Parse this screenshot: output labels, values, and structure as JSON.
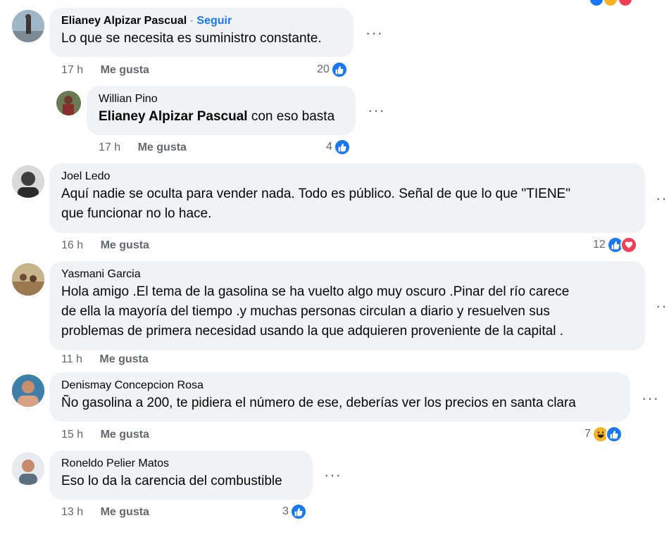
{
  "comments": [
    {
      "author": "Elianey Alpizar Pascual",
      "separator": "·",
      "follow_label": "Seguir",
      "text": "Lo que se necesita es suministro constante.",
      "time": "17 h",
      "like_label": "Me gusta",
      "reaction_count": "20",
      "reactions": [
        "like-icon"
      ]
    },
    {
      "author": "Willian Pino",
      "mention": "Elianey Alpizar Pascual",
      "text": " con eso basta",
      "time": "17 h",
      "like_label": "Me gusta",
      "reaction_count": "4",
      "reactions": [
        "like-icon"
      ]
    },
    {
      "author": "Joel Ledo",
      "text_line1": "Aquí nadie se oculta para vender nada. Todo es público. Señal de que lo que \"TIENE\"",
      "text_line2": "que funcionar no lo hace.",
      "time": "16 h",
      "like_label": "Me gusta",
      "reaction_count": "12",
      "reactions": [
        "like-icon",
        "love-icon"
      ]
    },
    {
      "author": "Yasmani Garcia",
      "text_line1": "Hola amigo .El tema de la gasolina se ha vuelto algo muy oscuro .Pinar del río carece",
      "text_line2": "de ella la mayoría del tiempo .y muchas personas circulan a diario y resuelven sus",
      "text_line3": "problemas de primera necesidad usando la que adquieren proveniente de la capital .",
      "time": "11 h",
      "like_label": "Me gusta"
    },
    {
      "author": "Denismay Concepcion Rosa",
      "text": "Ño gasolina a 200, te pidiera el número de ese, deberías ver los precios en santa clara",
      "time": "15 h",
      "like_label": "Me gusta",
      "reaction_count": "7",
      "reactions": [
        "haha-icon",
        "like-icon"
      ]
    },
    {
      "author": "Roneldo Pelier Matos",
      "text": "Eso lo da la carencia del combustible",
      "time": "13 h",
      "like_label": "Me gusta",
      "reaction_count": "3",
      "reactions": [
        "like-icon"
      ]
    }
  ],
  "more_label": "···",
  "colors": {
    "bubble": "#f0f2f5",
    "secondary_text": "#65676b",
    "link_blue": "#1877f2",
    "love": "#f33e58",
    "haha": "#f7b125"
  }
}
